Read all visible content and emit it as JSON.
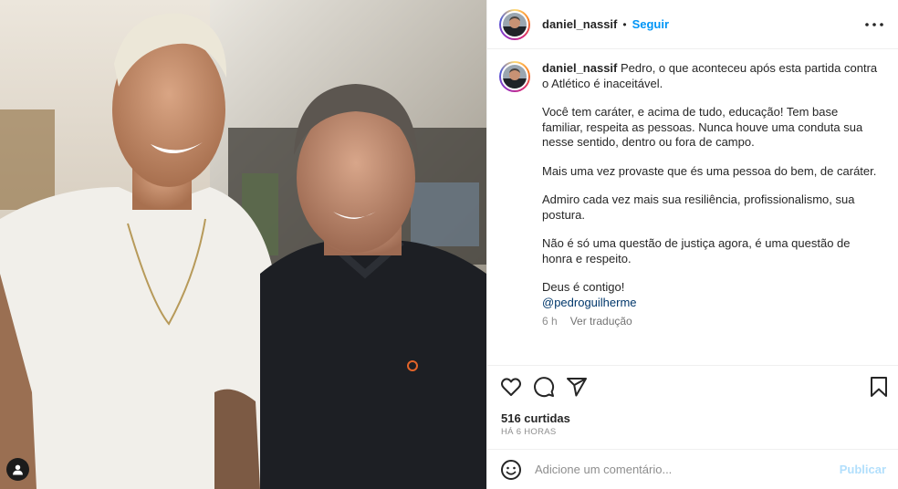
{
  "header": {
    "username": "daniel_nassif",
    "separator": "•",
    "follow_label": "Seguir"
  },
  "caption": {
    "username": "daniel_nassif",
    "paragraphs": [
      "Pedro, o que aconteceu após esta partida contra o Atlético é inaceitável.",
      "Você tem caráter, e acima de tudo, educação! Tem base familiar, respeita as pessoas. Nunca houve uma conduta sua nesse sentido, dentro ou fora de campo.",
      "Mais uma vez provaste que és uma pessoa do bem, de caráter.",
      "Admiro cada vez mais sua resiliência, profissionalismo, sua postura.",
      "Não é só uma questão de justiça agora, é uma questão de honra e respeito.",
      "Deus é contigo!"
    ],
    "mention": "@pedroguilherme",
    "age": "6 h",
    "translate_label": "Ver tradução"
  },
  "actions": {
    "like_icon": "heart-icon",
    "comment_icon": "comment-icon",
    "share_icon": "share-icon",
    "save_icon": "bookmark-icon"
  },
  "stats": {
    "likes": "516 curtidas",
    "posted": "HÁ 6 HORAS"
  },
  "comment": {
    "placeholder": "Adicione um comentário...",
    "publish_label": "Publicar",
    "emoji_icon": "emoji-icon"
  },
  "photo": {
    "tag_icon": "user-tag-icon"
  }
}
